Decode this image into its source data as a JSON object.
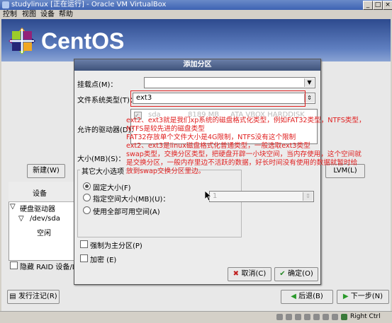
{
  "window": {
    "title": "studylinux [正在运行] - Oracle VM VirtualBox",
    "menu": [
      "控制",
      "视图",
      "设备",
      "帮助"
    ]
  },
  "banner": {
    "logo_text": "CentOS"
  },
  "installer": {
    "new_button": "新建(W)",
    "lvm_button": "LVM(L)",
    "device_header": "设备",
    "tree": [
      "硬盘驱动器",
      "/dev/sda",
      "空闲"
    ],
    "hide_raid": "隐藏 RAID 设备/LV",
    "release_notes": "发行注记(R)",
    "back_button": "后退(B)",
    "next_button": "下一步(N)"
  },
  "dialog": {
    "title": "添加分区",
    "mount_label": "挂载点(M)：",
    "mount_value": "",
    "fstype_label": "文件系统类型(T)：",
    "fstype_value": "ext3",
    "drives_label": "允许的驱动器(D)：",
    "drive_row": {
      "checked": true,
      "name": "sda",
      "size": "8189 MB",
      "model": "ATA VBOX HARDDISK"
    },
    "size_label": "大小(MB)(S)：",
    "options_title": "其它大小选项",
    "opt_fixed": "固定大小(F)",
    "opt_upto": "指定空间大小(MB)(U)：",
    "opt_upto_value": "1",
    "opt_fill": "使用全部可用空间(A)",
    "force_primary": "强制为主分区(P)",
    "encrypt": "加密 (E)",
    "cancel_button": "取消(C)",
    "ok_button": "确定(O)"
  },
  "annotation": {
    "lines": [
      "ext2、ext3就是我们xp系统的磁盘格式化类型，例如FAT32类型，NTFS类型，",
      "NTFS是较先进的磁盘类型",
      "FAT32存放单个文件大小是4G限制，NTFS没有这个限制",
      "ext2、ext3是linux磁盘格式化普通类型，一般选取ext3类型",
      "swap类型，交换分区类型，把硬盘开辟一小块空间，当内存使用，这个空间就",
      "是交换分区，一般内存里边不活跃的数据，好长时间没有使用的数据就暂时给",
      "放到swap交换分区里边。"
    ],
    "color": "#e02020"
  },
  "statusbar": {
    "host_key": "Right Ctrl"
  },
  "colors": {
    "banner_top": "#2d4a8e",
    "annotation": "#e02020",
    "dialog_title": "#3e527a"
  }
}
